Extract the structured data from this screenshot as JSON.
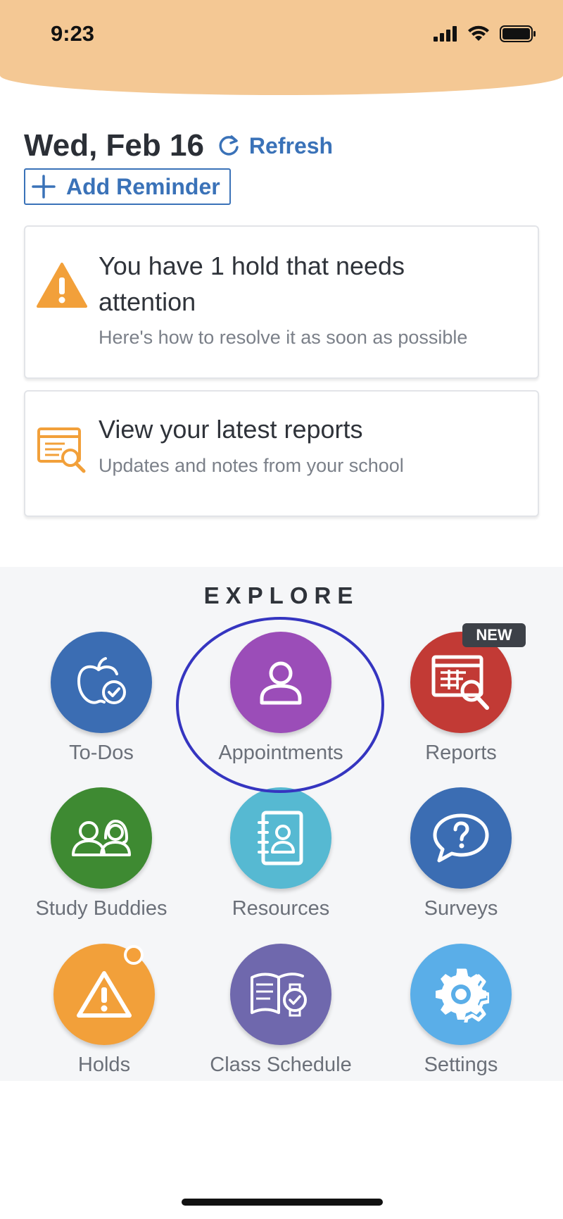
{
  "status_bar": {
    "time": "9:23"
  },
  "header": {
    "date": "Wed, Feb 16",
    "refresh_label": "Refresh",
    "add_reminder_label": "Add Reminder"
  },
  "cards": {
    "hold": {
      "title_line1": "You have 1 hold that needs",
      "title_line2": "attention",
      "subtitle": "Here's how to resolve it as soon as possible",
      "icon": "warning-icon"
    },
    "reports": {
      "title": "View your latest reports",
      "subtitle": "Updates and notes from your school",
      "icon": "report-search-icon"
    }
  },
  "explore": {
    "title": "EXPLORE",
    "new_badge": "NEW",
    "tiles": [
      {
        "label": "To-Dos",
        "icon": "apple-check-icon",
        "color": "#3b6db3"
      },
      {
        "label": "Appointments",
        "icon": "person-icon",
        "color": "#9b4db8"
      },
      {
        "label": "Reports",
        "icon": "report-search-icon",
        "color": "#c23a35"
      },
      {
        "label": "Study Buddies",
        "icon": "two-people-icon",
        "color": "#3e8a32"
      },
      {
        "label": "Resources",
        "icon": "address-book-icon",
        "color": "#56b9d2"
      },
      {
        "label": "Surveys",
        "icon": "question-bubble-icon",
        "color": "#3b6db3"
      },
      {
        "label": "Holds",
        "icon": "warning-icon",
        "color": "#f2a03a"
      },
      {
        "label": "Class Schedule",
        "icon": "book-watch-icon",
        "color": "#6f68ad"
      },
      {
        "label": "Settings",
        "icon": "gear-icon",
        "color": "#5aaee8"
      }
    ]
  },
  "colors": {
    "header_band": "#f4c894",
    "accent_blue": "#3a72b8",
    "highlight_ring": "#3535c0",
    "warning_orange": "#f2a03a"
  }
}
